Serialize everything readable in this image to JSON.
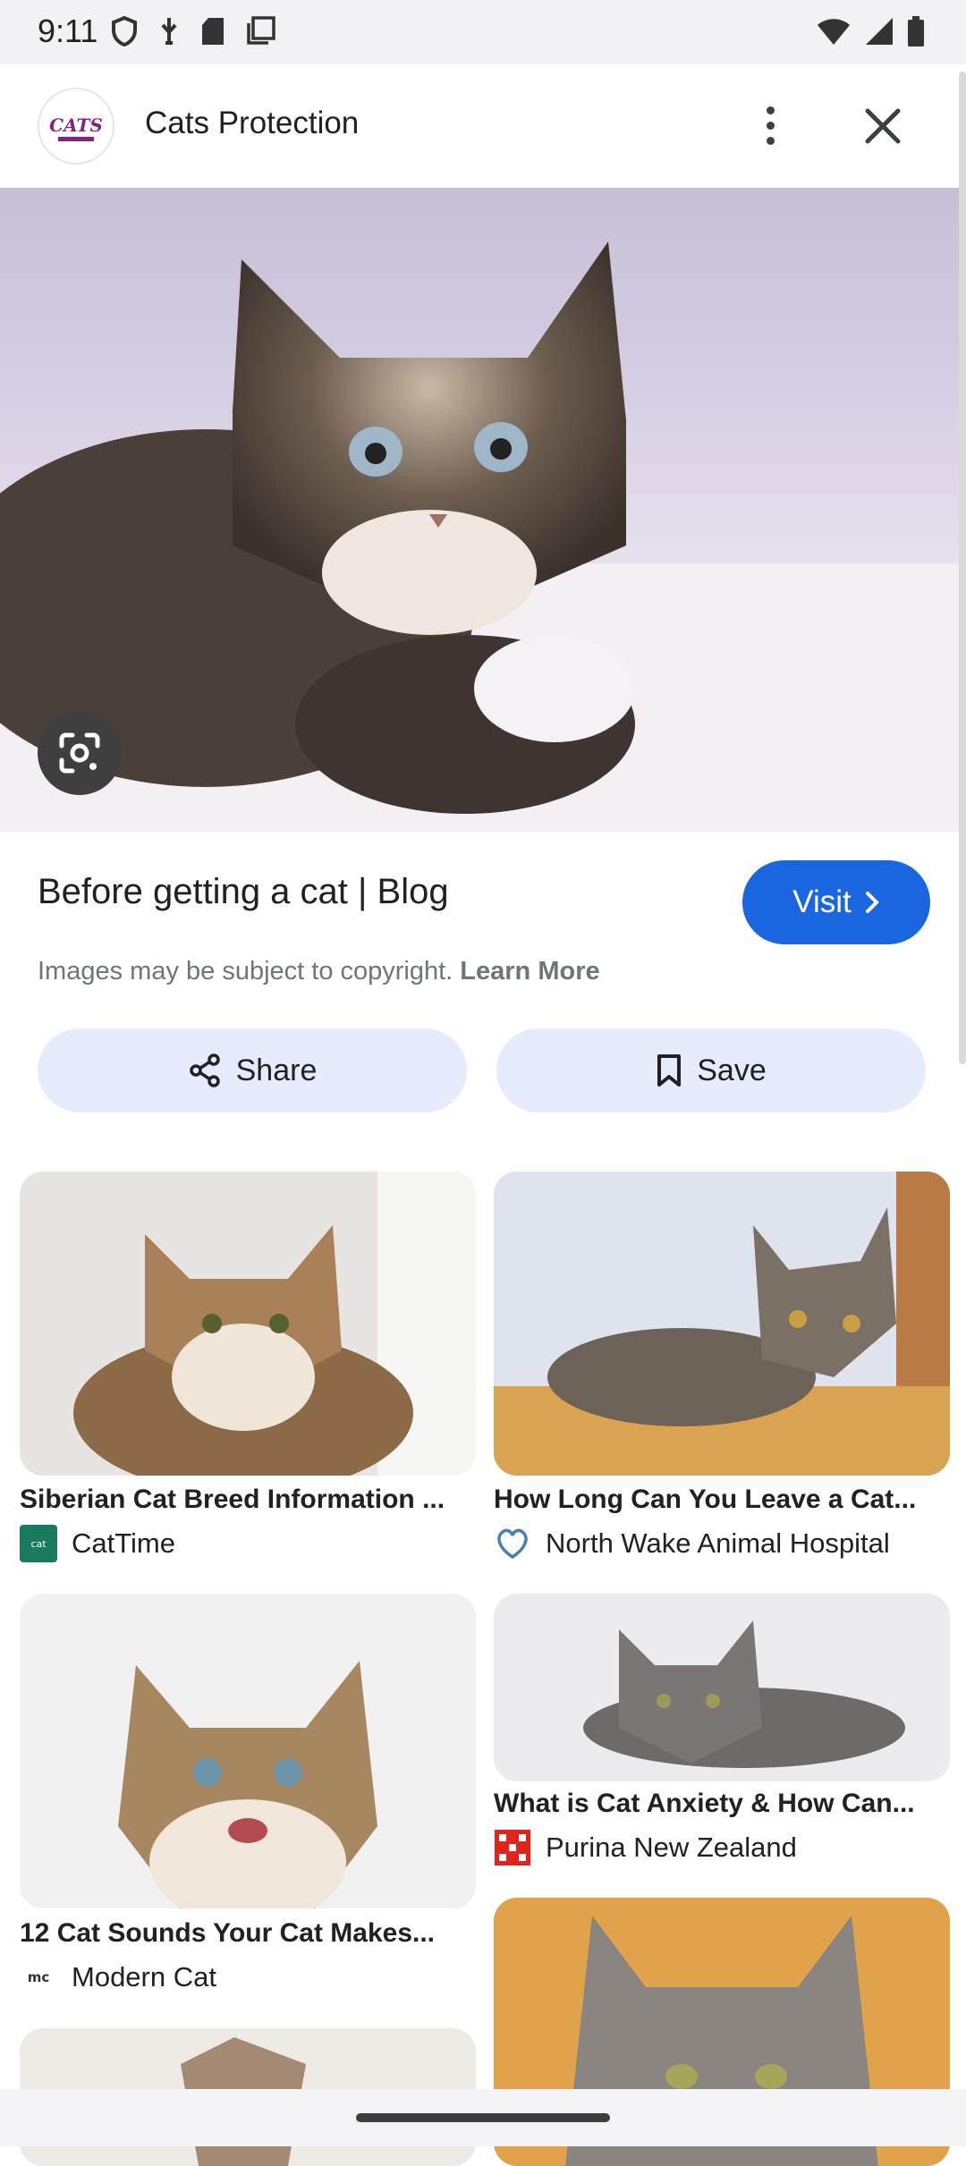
{
  "status_bar": {
    "time": "9:11"
  },
  "header": {
    "site_name": "Cats Protection",
    "logo_text": "CATS"
  },
  "result": {
    "title": "Before getting a cat | Blog",
    "visit_label": "Visit",
    "copyright_text": "Images may be subject to copyright.",
    "learn_more": "Learn More",
    "share_label": "Share",
    "save_label": "Save"
  },
  "related": [
    {
      "title": "Siberian Cat Breed Information ...",
      "source": "CatTime"
    },
    {
      "title": "How Long Can You Leave a Cat...",
      "source": "North Wake Animal Hospital"
    },
    {
      "title": "12 Cat Sounds Your Cat Makes...",
      "source": "Modern Cat"
    },
    {
      "title": "What is Cat Anxiety & How Can...",
      "source": "Purina New Zealand"
    }
  ],
  "colors": {
    "accent": "#1a66e0",
    "tonal_button": "#e6ecfb",
    "status_bar_bg": "#f1f1f6"
  }
}
